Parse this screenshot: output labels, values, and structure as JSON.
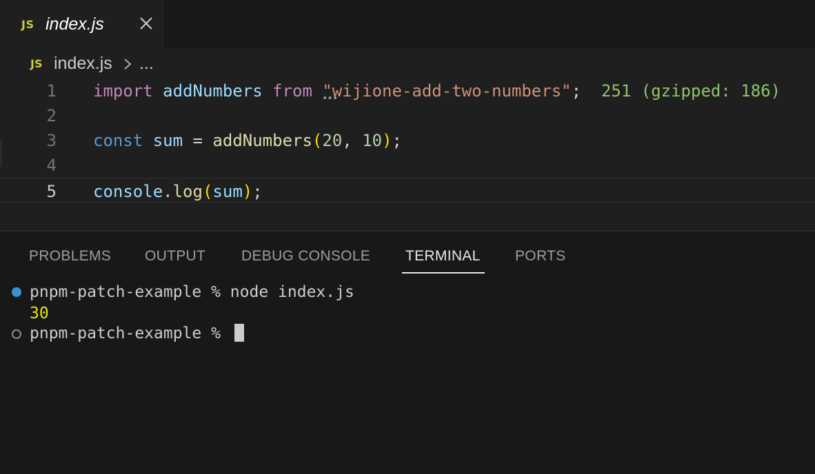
{
  "tab": {
    "icon": "js-file-icon",
    "icon_text": "JS",
    "label": "index.js",
    "close_icon": "close-icon"
  },
  "breadcrumb": {
    "icon_text": "JS",
    "file": "index.js",
    "separator_icon": "chevron-right-icon",
    "more": "..."
  },
  "editor": {
    "active_line": 5,
    "lines": [
      {
        "number": "1",
        "tokens": [
          "import",
          " ",
          "addNumbers",
          " ",
          "from",
          " ",
          "\"wijione-add-two-numbers\"",
          ";",
          "  ",
          "251 (gzipped: 186)"
        ]
      },
      {
        "number": "2",
        "tokens": []
      },
      {
        "number": "3",
        "tokens": [
          "const",
          " ",
          "sum",
          " = ",
          "addNumbers",
          "(",
          "20",
          ", ",
          "10",
          ")",
          ";"
        ]
      },
      {
        "number": "4",
        "tokens": []
      },
      {
        "number": "5",
        "tokens": [
          "console",
          ".",
          "log",
          "(",
          "sum",
          ")",
          ";"
        ]
      }
    ],
    "import_cost_hint": "251 (gzipped: 186)"
  },
  "panel": {
    "tabs": [
      {
        "label": "PROBLEMS",
        "active": false
      },
      {
        "label": "OUTPUT",
        "active": false
      },
      {
        "label": "DEBUG CONSOLE",
        "active": false
      },
      {
        "label": "TERMINAL",
        "active": true
      },
      {
        "label": "PORTS",
        "active": false
      }
    ]
  },
  "terminal": {
    "lines": [
      {
        "text": "pnpm-patch-example % node index.js",
        "marker": "success-dot-icon"
      },
      {
        "text": "30",
        "marker": null
      },
      {
        "text": "pnpm-patch-example % ",
        "marker": "empty-dot-icon"
      }
    ]
  },
  "colors": {
    "keyword_import": "#c586c0",
    "keyword_const": "#569cd6",
    "variable": "#9cdcfe",
    "function": "#dcdcaa",
    "string": "#ce9178",
    "number": "#b5cea8",
    "bracket": "#ffd700",
    "hint": "#8fc46c",
    "terminal_output": "#e5e510",
    "success_dot": "#3794d1",
    "js_icon": "#cbcb41"
  }
}
